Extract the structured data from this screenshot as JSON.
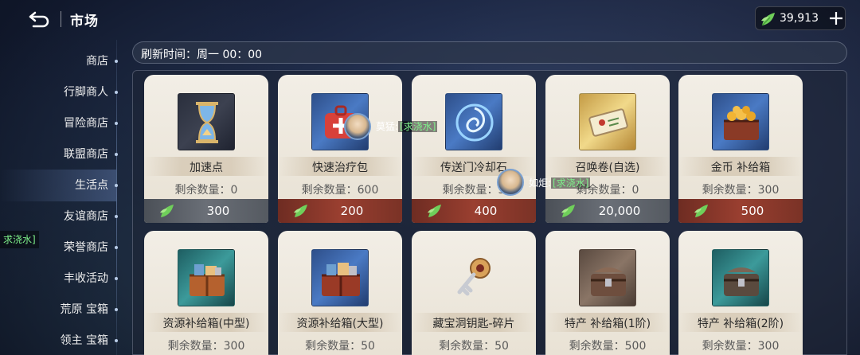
{
  "header": {
    "title": "市场",
    "currency_value": "39,913"
  },
  "refresh": {
    "text": "刷新时间：周一 00：00"
  },
  "sidebar": {
    "items": [
      {
        "label": "商店"
      },
      {
        "label": "行脚商人"
      },
      {
        "label": "冒险商店"
      },
      {
        "label": "联盟商店"
      },
      {
        "label": "生活点",
        "active": true
      },
      {
        "label": "友谊商店"
      },
      {
        "label": "荣誉商店"
      },
      {
        "label": "丰收活动"
      },
      {
        "label": "荒原 宝箱"
      },
      {
        "label": "领主 宝箱"
      }
    ]
  },
  "chat_left": "求浇水]",
  "chats": [
    {
      "name": "莫猛:",
      "msg": "[求浇水]"
    },
    {
      "name": "如炬:",
      "msg": "[求浇水]"
    }
  ],
  "items": [
    {
      "name": "加速点",
      "stock": "剩余数量：0",
      "price": "300",
      "icon": "hourglass-icon",
      "frame": "dark",
      "price_style": "gray"
    },
    {
      "name": "快速治疗包",
      "stock": "剩余数量：600",
      "price": "200",
      "icon": "medkit-icon",
      "frame": "blue",
      "price_style": "red"
    },
    {
      "name": "传送门冷却石",
      "stock": "剩余数量：3",
      "price": "400",
      "icon": "portal-stone-icon",
      "frame": "blue",
      "price_style": "red"
    },
    {
      "name": "召唤卷(自选)",
      "stock": "剩余数量：0",
      "price": "20,000",
      "icon": "scroll-icon",
      "frame": "gold",
      "price_style": "gray"
    },
    {
      "name": "金币 补给箱",
      "stock": "剩余数量：300",
      "price": "500",
      "icon": "gold-chest-icon",
      "frame": "blue",
      "price_style": "red"
    },
    {
      "name": "资源补给箱(中型)",
      "stock": "剩余数量：300",
      "icon": "resource-chest-icon",
      "frame": "teal"
    },
    {
      "name": "资源补给箱(大型)",
      "stock": "剩余数量：50",
      "icon": "resource-chest-large-icon",
      "frame": "blue"
    },
    {
      "name": "藏宝洞钥匙-碎片",
      "stock": "剩余数量：50",
      "icon": "key-fragment-icon",
      "frame": "none"
    },
    {
      "name": "特产 补给箱(1阶)",
      "stock": "剩余数量：500",
      "icon": "specialty-chest-icon",
      "frame": "brown"
    },
    {
      "name": "特产 补给箱(2阶)",
      "stock": "剩余数量：300",
      "icon": "specialty-chest-2-icon",
      "frame": "teal"
    }
  ]
}
